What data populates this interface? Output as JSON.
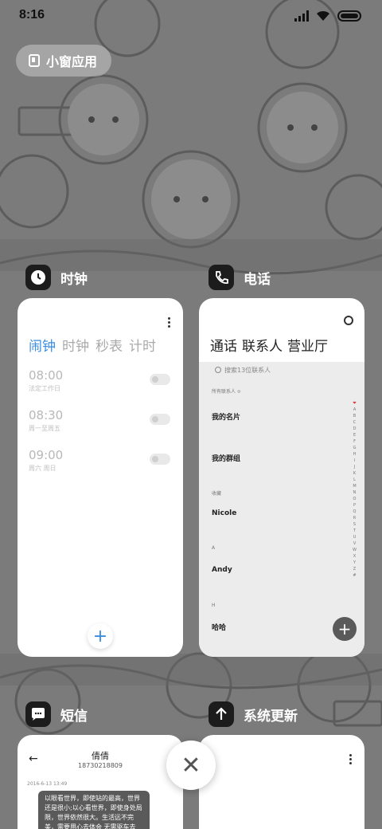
{
  "status": {
    "time": "8:16"
  },
  "pill": {
    "label": "小窗应用"
  },
  "apps": {
    "clock": {
      "name": "时钟",
      "tabs": [
        "闹钟",
        "时钟",
        "秒表",
        "计时"
      ],
      "alarms": [
        {
          "time": "08:00",
          "repeat": "法定工作日"
        },
        {
          "time": "08:30",
          "repeat": "周一至周五"
        },
        {
          "time": "09:00",
          "repeat": "周六 周日"
        }
      ],
      "add": "+"
    },
    "phone": {
      "name": "电话",
      "tabs": [
        "通话",
        "联系人",
        "营业厅"
      ],
      "search_placeholder": "搜索13位联系人",
      "filter": "所有联系人 ≎",
      "my_card": "我的名片",
      "my_groups": "我的群组",
      "favorites": "收藏",
      "contacts": [
        "Nicole",
        "Andy",
        "哈哈"
      ],
      "section_a": "A",
      "section_h": "H",
      "index": [
        "❤",
        "A",
        "B",
        "C",
        "D",
        "E",
        "F",
        "G",
        "H",
        "I",
        "J",
        "K",
        "L",
        "M",
        "N",
        "O",
        "P",
        "Q",
        "R",
        "S",
        "T",
        "U",
        "V",
        "W",
        "X",
        "Y",
        "Z",
        "#"
      ],
      "add": "+"
    },
    "messages": {
      "name": "短信",
      "contact": "倩倩",
      "number": "18730218809",
      "date": "2016-6-13 13:49",
      "bubble": "以眼看世界，即使站的最高，世界还是很小;以心看世界，即使身处局限，世界依然很大。生活远不完美，需要用心去体会 无需驱车去"
    },
    "update": {
      "name": "系统更新"
    }
  },
  "close": "✕"
}
